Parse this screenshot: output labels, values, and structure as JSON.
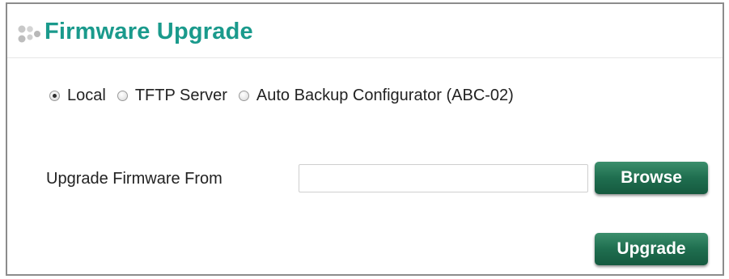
{
  "header": {
    "title": "Firmware Upgrade",
    "icon": "dots-icon",
    "title_color": "#1a9a8c"
  },
  "source": {
    "options": [
      {
        "label": "Local",
        "checked": true
      },
      {
        "label": "TFTP Server",
        "checked": false
      },
      {
        "label": "Auto Backup Configurator (ABC-02)",
        "checked": false
      }
    ]
  },
  "form": {
    "upgrade_from_label": "Upgrade Firmware From",
    "file_value": "",
    "browse_label": "Browse",
    "upgrade_label": "Upgrade",
    "button_color": "#1f6e4f"
  }
}
